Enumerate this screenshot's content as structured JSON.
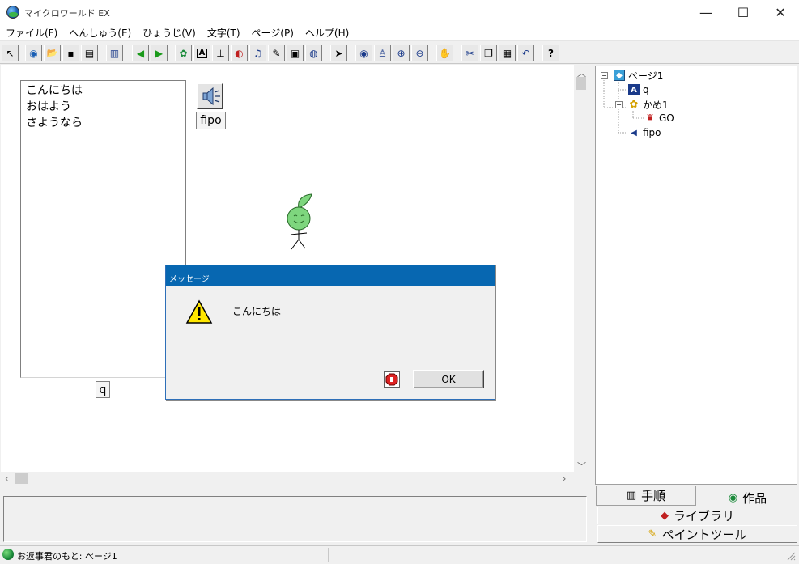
{
  "window": {
    "title": "マイクロワールド EX",
    "controls": {
      "minimize": "—",
      "maximize": "☐",
      "close": "✕"
    }
  },
  "menu": [
    "ファイル(F)",
    "へんしゅう(E)",
    "ひょうじ(V)",
    "文字(T)",
    "ページ(P)",
    "ヘルプ(H)"
  ],
  "toolbar": {
    "icons": [
      "pointer-icon",
      "globe-icon",
      "open-folder-icon",
      "save-icon",
      "print-icon",
      "page-view-icon",
      "arrow-left-icon",
      "arrow-right-icon",
      "hatch-icon",
      "textbox-icon",
      "rod-icon",
      "paint-icon",
      "music-icon",
      "pen-icon",
      "movie-icon",
      "camera-icon",
      "select-arrow-icon",
      "eye-icon",
      "stamp-icon",
      "zoom-in-icon",
      "zoom-out-icon",
      "stop-icon",
      "cut-icon",
      "copy-icon",
      "paste-icon",
      "undo-icon",
      "help-icon"
    ],
    "glyphs": [
      "↖",
      "◉",
      "📂",
      "▪",
      "▤",
      "▥",
      "◀",
      "▶",
      "✿",
      "A",
      "⊥",
      "◐",
      "♫",
      "✎",
      "▣",
      "◍",
      "➤",
      "◉",
      "♙",
      "⊕",
      "⊖",
      "✋",
      "✂",
      "❐",
      "▦",
      "↶",
      "?"
    ]
  },
  "canvas": {
    "listbox_items": [
      "こんにちは",
      "おはよう",
      "さようなら"
    ],
    "listbox_caption": "q",
    "sound_caption": "fipo"
  },
  "dialog": {
    "title": "メッセージ",
    "message": "こんにちは",
    "ok_label": "OK"
  },
  "tree": [
    {
      "label": "ページ1"
    },
    {
      "label": "q"
    },
    {
      "label": "かめ1"
    },
    {
      "label": "GO"
    },
    {
      "label": "fipo"
    }
  ],
  "tabs": {
    "procedures": "手順",
    "works": "作品"
  },
  "panel_buttons": {
    "library": "ライブラリ",
    "paint_tool": "ペイントツール"
  },
  "status": {
    "text": "お返事君のもと: ページ1"
  },
  "colors": {
    "dialog_title_bg": "#0767b1",
    "tree_turtle": "#f4c430"
  }
}
